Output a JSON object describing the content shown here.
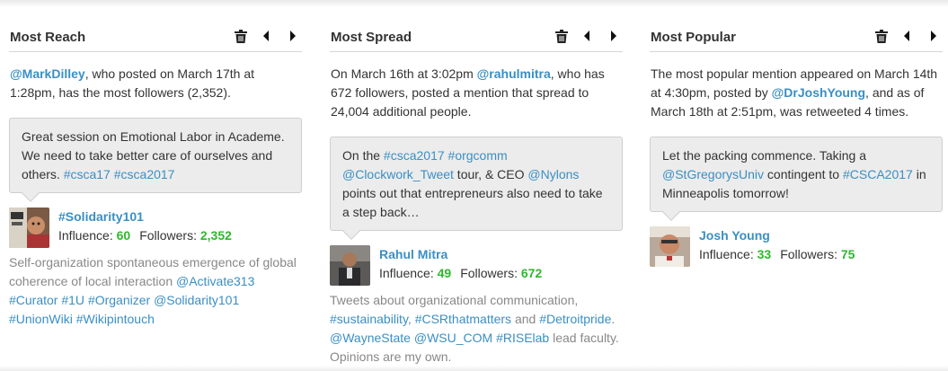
{
  "cards": [
    {
      "title": "Most Reach",
      "summary": {
        "handle": "@MarkDilley",
        "text": ", who posted on March 17th at 1:28pm, has the most followers (2,352)."
      },
      "quote": {
        "text": "Great session on Emotional Labor in Academe. We need to take better care of ourselves and others. ",
        "tags": [
          "#csca17",
          "#csca2017"
        ]
      },
      "person": {
        "name": "#Solidarity101",
        "influence_label": "Influence:",
        "influence": "60",
        "followers_label": "Followers:",
        "followers": "2,352"
      },
      "bio": {
        "text": "Self-organization spontaneous emergence of global coherence of local interaction ",
        "tags": [
          "@Activate313",
          "#Curator",
          "#1U",
          "#Organizer",
          "@Solidarity101",
          "#UnionWiki",
          "#Wikipintouch"
        ]
      }
    },
    {
      "title": "Most Spread",
      "summary": {
        "pre": "On March 16th at 3:02pm ",
        "handle": "@rahulmitra",
        "text": ", who has 672 followers, posted a mention that spread to 24,004 additional people."
      },
      "quote": {
        "pre": "On the ",
        "tag1": "#csca2017",
        "tag2": "#orgcomm",
        "tag3": "@Clockwork_Tweet",
        "mid": " tour, & CEO ",
        "tag4": "@Nylons",
        "post": " points out that entrepreneurs also need to take a step back…"
      },
      "person": {
        "name": "Rahul Mitra",
        "influence_label": "Influence:",
        "influence": "49",
        "followers_label": "Followers:",
        "followers": "672"
      },
      "bio": {
        "pre": "Tweets about organizational communication, ",
        "t1": "#sustainability",
        "t2": "#CSRthatmatters",
        "and": " and ",
        "t3": "#Detroitpride",
        "t4": "@WayneState",
        "t5": "@WSU_COM",
        "t6": "#RISElab",
        "post": " lead faculty. Opinions are my own."
      }
    },
    {
      "title": "Most Popular",
      "summary": {
        "pre": "The most popular mention appeared on March 14th at 4:30pm, posted by ",
        "handle": "@DrJoshYoung",
        "text": ", and as of March 18th at 2:51pm, was retweeted 4 times."
      },
      "quote": {
        "pre": "Let the packing commence. Taking a ",
        "tag1": "@StGregorysUniv",
        "mid": " contingent to ",
        "tag2": "#CSCA2017",
        "post": " in Minneapolis tomorrow!"
      },
      "person": {
        "name": "Josh Young",
        "influence_label": "Influence:",
        "influence": "33",
        "followers_label": "Followers:",
        "followers": "75"
      }
    }
  ],
  "icons": [
    "trash-icon",
    "previous-arrow-icon",
    "next-arrow-icon"
  ],
  "colors": {
    "link": "#3a8fc4",
    "number": "#2eb82e",
    "bubble": "#ececec",
    "muted": "#888888"
  }
}
